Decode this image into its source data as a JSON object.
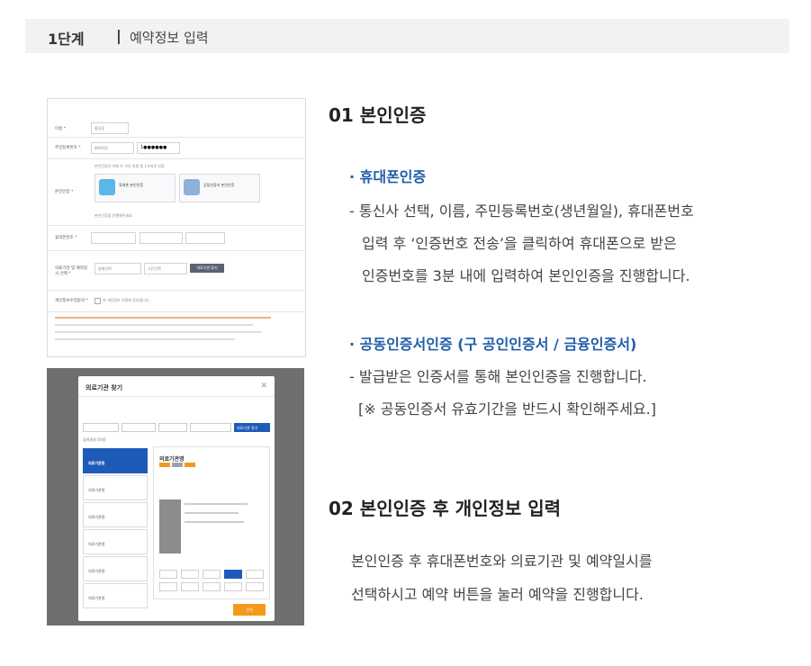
{
  "header": {
    "step": "1단계",
    "separator": "|",
    "description": "예약정보 입력"
  },
  "section1": {
    "title": "01 본인인증",
    "phone_auth": {
      "title": "· 휴대폰인증",
      "lines": [
        "- 통신사 선택, 이름, 주민등록번호(생년월일), 휴대폰번호",
        "입력 후 ‘인증번호 전송’을 클릭하여 휴대폰으로 받은",
        "인증번호를 3분 내에 입력하여 본인인증을 진행합니다."
      ]
    },
    "cert_auth": {
      "title": "· 공동인증서인증 (구 공인인증서 / 금융인증서)",
      "lines": [
        "- 발급받은 인증서를 통해 본인인증을 진행합니다.",
        "[※ 공동인증서 유효기간을 반드시 확인해주세요.]"
      ]
    }
  },
  "section2": {
    "title": "02 본인인증 후 개인정보 입력",
    "lines": [
      "본인인증 후 휴대폰번호와 의료기관 및 예약일시를",
      "선택하시고 예약 버튼을 눌러 예약을 진행합니다."
    ]
  },
  "form_screenshot": {
    "name_label": "이름 *",
    "name_value": "홍길동",
    "rrn_label": "주민등록번호 *",
    "rrn_front": "900101",
    "rrn_back": "1●●●●●●",
    "auth_label": "본인인증 *",
    "auth_note": "본인인증은 아래 두 가지 방법 중 1가지로 인증",
    "phone_option": "휴대폰 본인인증",
    "cert_option": "공동인증서 본인인증",
    "auth_done_note": "본인인증을 진행해주세요",
    "phone_label": "휴대폰번호 *",
    "hospital_label": "의료기관 및 예약일시 선택 *",
    "date_value": "날짜선택",
    "time_value": "시간선택",
    "find_hospital_button": "의료기관 찾기",
    "privacy_label": "개인정보수집동의 *",
    "privacy_check": "위 개인정보 이용에 동의합니다."
  },
  "modal_screenshot": {
    "title": "의료기관 찾기",
    "search_button": "의료기관 찾기",
    "result_count": "검색결과 [0개]",
    "list_item_label": "의료기관명",
    "detail_title": "의료기관명",
    "confirm_button": "선택",
    "colors": {
      "primary": "#1e5bb8",
      "confirm": "#f39a1d"
    }
  }
}
